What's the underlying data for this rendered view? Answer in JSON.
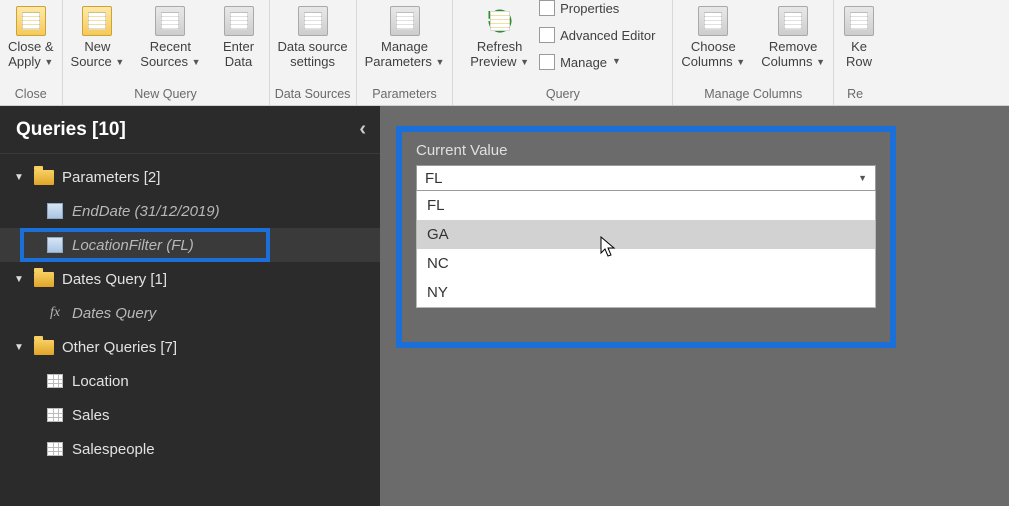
{
  "ribbon": {
    "close": {
      "group_label": "Close",
      "close_apply": "Close &\nApply"
    },
    "new_query": {
      "group_label": "New Query",
      "new_source": "New\nSource",
      "recent_sources": "Recent\nSources",
      "enter_data": "Enter\nData"
    },
    "data_sources": {
      "group_label": "Data Sources",
      "data_source_settings": "Data source\nsettings"
    },
    "parameters": {
      "group_label": "Parameters",
      "manage_parameters": "Manage\nParameters"
    },
    "query": {
      "group_label": "Query",
      "refresh_preview": "Refresh\nPreview",
      "properties": "Properties",
      "advanced_editor": "Advanced Editor",
      "manage": "Manage"
    },
    "manage_columns": {
      "group_label": "Manage Columns",
      "choose_columns": "Choose\nColumns",
      "remove_columns": "Remove\nColumns"
    },
    "rows": {
      "group_label": "Re",
      "keep_rows": "Ke\nRow"
    }
  },
  "sidebar": {
    "title": "Queries [10]",
    "groups": [
      {
        "label": "Parameters [2]",
        "items": [
          {
            "label": "EndDate (31/12/2019)",
            "kind": "param",
            "selected": false
          },
          {
            "label": "LocationFilter (FL)",
            "kind": "param",
            "selected": true,
            "outlined": true
          }
        ]
      },
      {
        "label": "Dates Query [1]",
        "items": [
          {
            "label": "Dates Query",
            "kind": "fx"
          }
        ]
      },
      {
        "label": "Other Queries [7]",
        "items": [
          {
            "label": "Location",
            "kind": "table"
          },
          {
            "label": "Sales",
            "kind": "table"
          },
          {
            "label": "Salespeople",
            "kind": "table"
          }
        ]
      }
    ]
  },
  "main": {
    "current_value_label": "Current Value",
    "selected_value": "FL",
    "options": [
      "FL",
      "GA",
      "NC",
      "NY"
    ],
    "hover_index": 1
  }
}
